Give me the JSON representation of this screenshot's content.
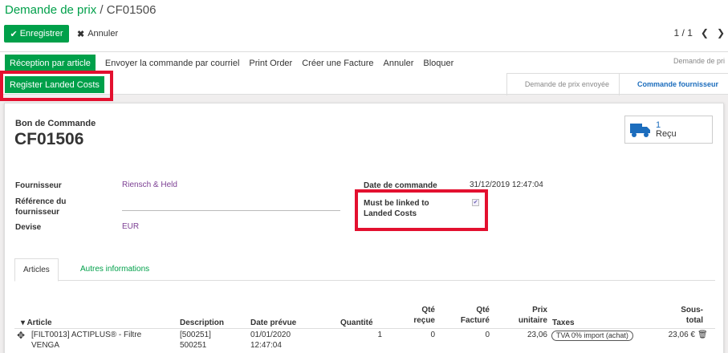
{
  "header": {
    "breadcrumb_parent": "Demande de prix",
    "breadcrumb_sep": "/",
    "breadcrumb_current": "CF01506",
    "save_label": "Enregistrer",
    "discard_label": "Annuler",
    "pager": "1 / 1"
  },
  "actions": {
    "reception": "Réception par article",
    "send_email": "Envoyer la commande par courriel",
    "print_order": "Print Order",
    "create_invoice": "Créer une Facture",
    "cancel": "Annuler",
    "block": "Bloquer",
    "landed_costs": "Register Landed Costs"
  },
  "status": {
    "top_right": "Demande de pri",
    "stages": [
      "Demande de prix envoyée",
      "Commande fournisseur"
    ]
  },
  "sheet": {
    "doc_label": "Bon de Commande",
    "doc_name": "CF01506",
    "stat_value": "1",
    "stat_label": "Reçu",
    "fields": {
      "supplier_label": "Fournisseur",
      "supplier_value": "Riensch & Held",
      "ref_label": "Référence du fournisseur",
      "currency_label": "Devise",
      "currency_value": "EUR",
      "date_label": "Date de commande",
      "date_value": "31/12/2019 12:47:04",
      "landed_label": "Must be linked to Landed Costs",
      "landed_checked": true
    },
    "tabs": [
      "Articles",
      "Autres informations"
    ]
  },
  "table": {
    "columns": [
      "Article",
      "Description",
      "Date prévue",
      "Quantité",
      "Qté reçue",
      "Qté Facturé",
      "Prix unitaire",
      "Taxes",
      "Sous-total"
    ],
    "rows": [
      {
        "article": "[FILT0013] ACTIPLUS® - Filtre VENGA",
        "description": "[500251] 500251",
        "date": "01/01/2020 12:47:04",
        "qty": "1",
        "qty_received": "0",
        "qty_invoiced": "0",
        "unit_price": "23,06",
        "tax": "TVA 0% import (achat)",
        "subtotal": "23,06 €"
      }
    ]
  },
  "colors": {
    "primary": "#00a04a",
    "highlight": "#e3102f",
    "link": "#7c3f93"
  }
}
